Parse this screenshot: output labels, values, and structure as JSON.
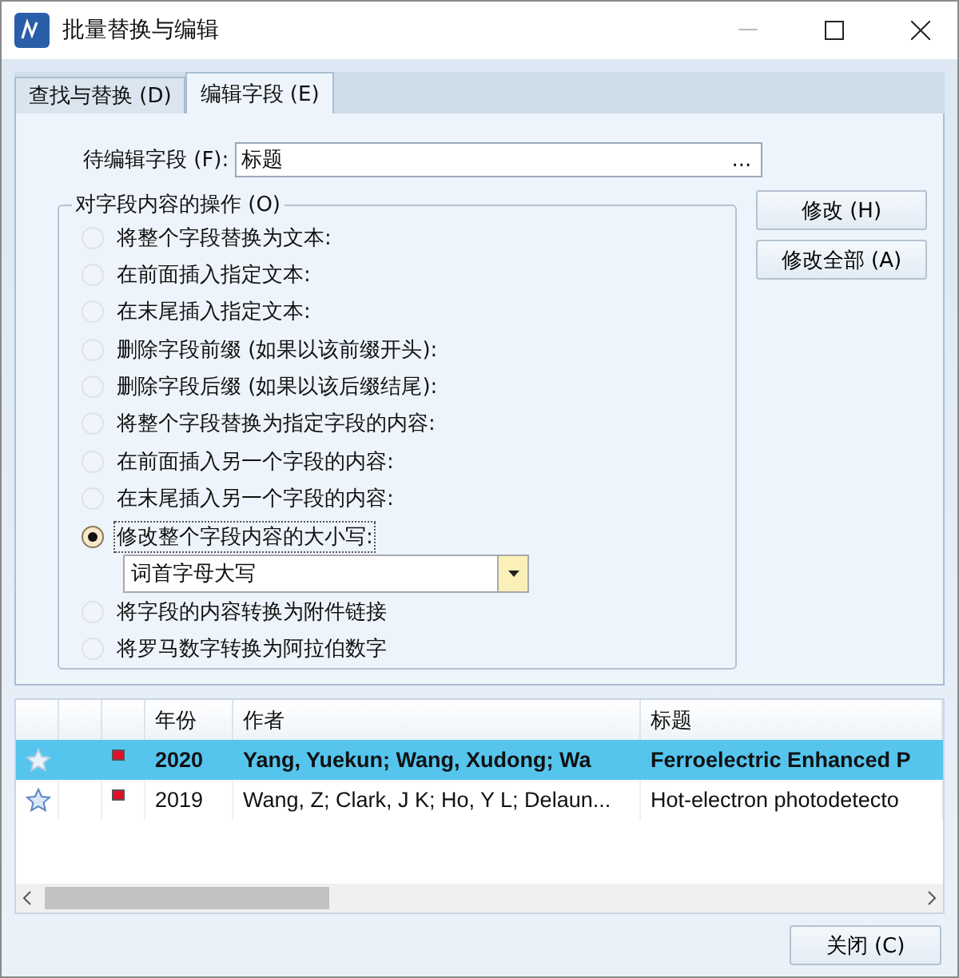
{
  "window": {
    "title": "批量替换与编辑"
  },
  "tabs": [
    {
      "label": "查找与替换 (D)",
      "selected": false
    },
    {
      "label": "编辑字段 (E)",
      "selected": true
    }
  ],
  "field": {
    "label": "待编辑字段 (F):",
    "value": "标题",
    "browse": "..."
  },
  "operations": {
    "title": "对字段内容的操作 (O)",
    "options": [
      {
        "label": "将整个字段替换为文本:",
        "selected": false
      },
      {
        "label": "在前面插入指定文本:",
        "selected": false
      },
      {
        "label": "在末尾插入指定文本:",
        "selected": false
      },
      {
        "label": "删除字段前缀 (如果以该前缀开头):",
        "selected": false
      },
      {
        "label": "删除字段后缀 (如果以该后缀结尾):",
        "selected": false
      },
      {
        "label": "将整个字段替换为指定字段的内容:",
        "selected": false
      },
      {
        "label": "在前面插入另一个字段的内容:",
        "selected": false
      },
      {
        "label": "在末尾插入另一个字段的内容:",
        "selected": false
      },
      {
        "label": "修改整个字段内容的大小写:",
        "selected": true,
        "dropdown": "词首字母大写"
      },
      {
        "label": "将字段的内容转换为附件链接",
        "selected": false
      },
      {
        "label": "将罗马数字转换为阿拉伯数字",
        "selected": false
      }
    ]
  },
  "buttons": [
    "修改 (H)",
    "修改全部 (A)"
  ],
  "table": {
    "columns": [
      "",
      "",
      "",
      "年份",
      "作者",
      "标题"
    ],
    "rows": [
      {
        "selected": true,
        "unread": true,
        "year": "2020",
        "author": "Yang, Yuekun; Wang, Xudong; Wa",
        "title": "Ferroelectric Enhanced P"
      },
      {
        "selected": false,
        "unread": false,
        "year": "2019",
        "author": "Wang, Z; Clark, J K; Ho, Y L; Delaun...",
        "title": "Hot-electron photodetecto"
      }
    ]
  },
  "close_button": "关闭 (C)"
}
